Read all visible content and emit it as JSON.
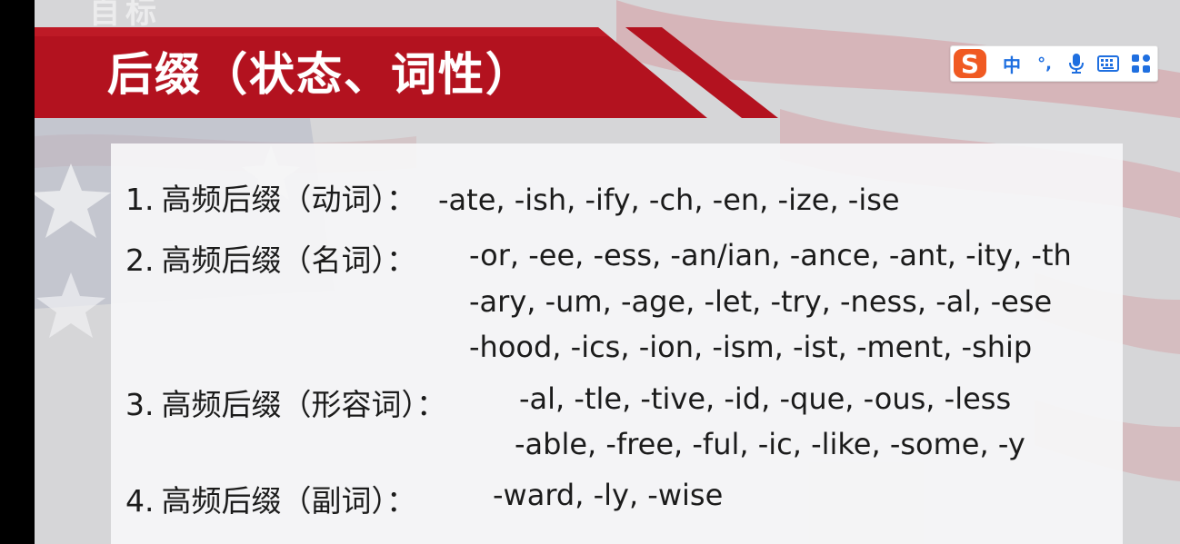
{
  "slide": {
    "title": "后缀（状态、词性）",
    "logo_text": "自标"
  },
  "rules": [
    {
      "number": "1.",
      "label": "高频后缀（动词）：",
      "lines": [
        "-ate, -ish, -ify, -ch, -en, -ize, -ise"
      ]
    },
    {
      "number": "2.",
      "label": "高频后缀（名词）：",
      "lines": [
        "-or, -ee, -ess, -an/ian, -ance, -ant, -ity, -th",
        "-ary, -um, -age, -let, -try, -ness, -al, -ese",
        "-hood, -ics, -ion, -ism, -ist, -ment, -ship"
      ]
    },
    {
      "number": "3.",
      "label": "高频后缀（形容词）：",
      "lines": [
        "-al, -tle, -tive, -id, -que, -ous, -less",
        "-able, -free, -ful, -ic, -like, -some, -y"
      ]
    },
    {
      "number": "4.",
      "label": "高频后缀（副词）：",
      "lines": [
        "-ward, -ly, -wise"
      ]
    }
  ],
  "ime_toolbar": {
    "logo_icon": "sogou-s-icon",
    "mode_label": "中",
    "punct_label": "°,",
    "voice_icon": "microphone-icon",
    "keyboard_icon": "keyboard-icon",
    "toolbox_icon": "apps-grid-icon",
    "accent_color": "#1f6fe0",
    "logo_color": "#f05a22"
  },
  "colors": {
    "banner_red": "#b3121f",
    "panel_bg": "#f6f6f7",
    "text": "#1b1b1b"
  }
}
